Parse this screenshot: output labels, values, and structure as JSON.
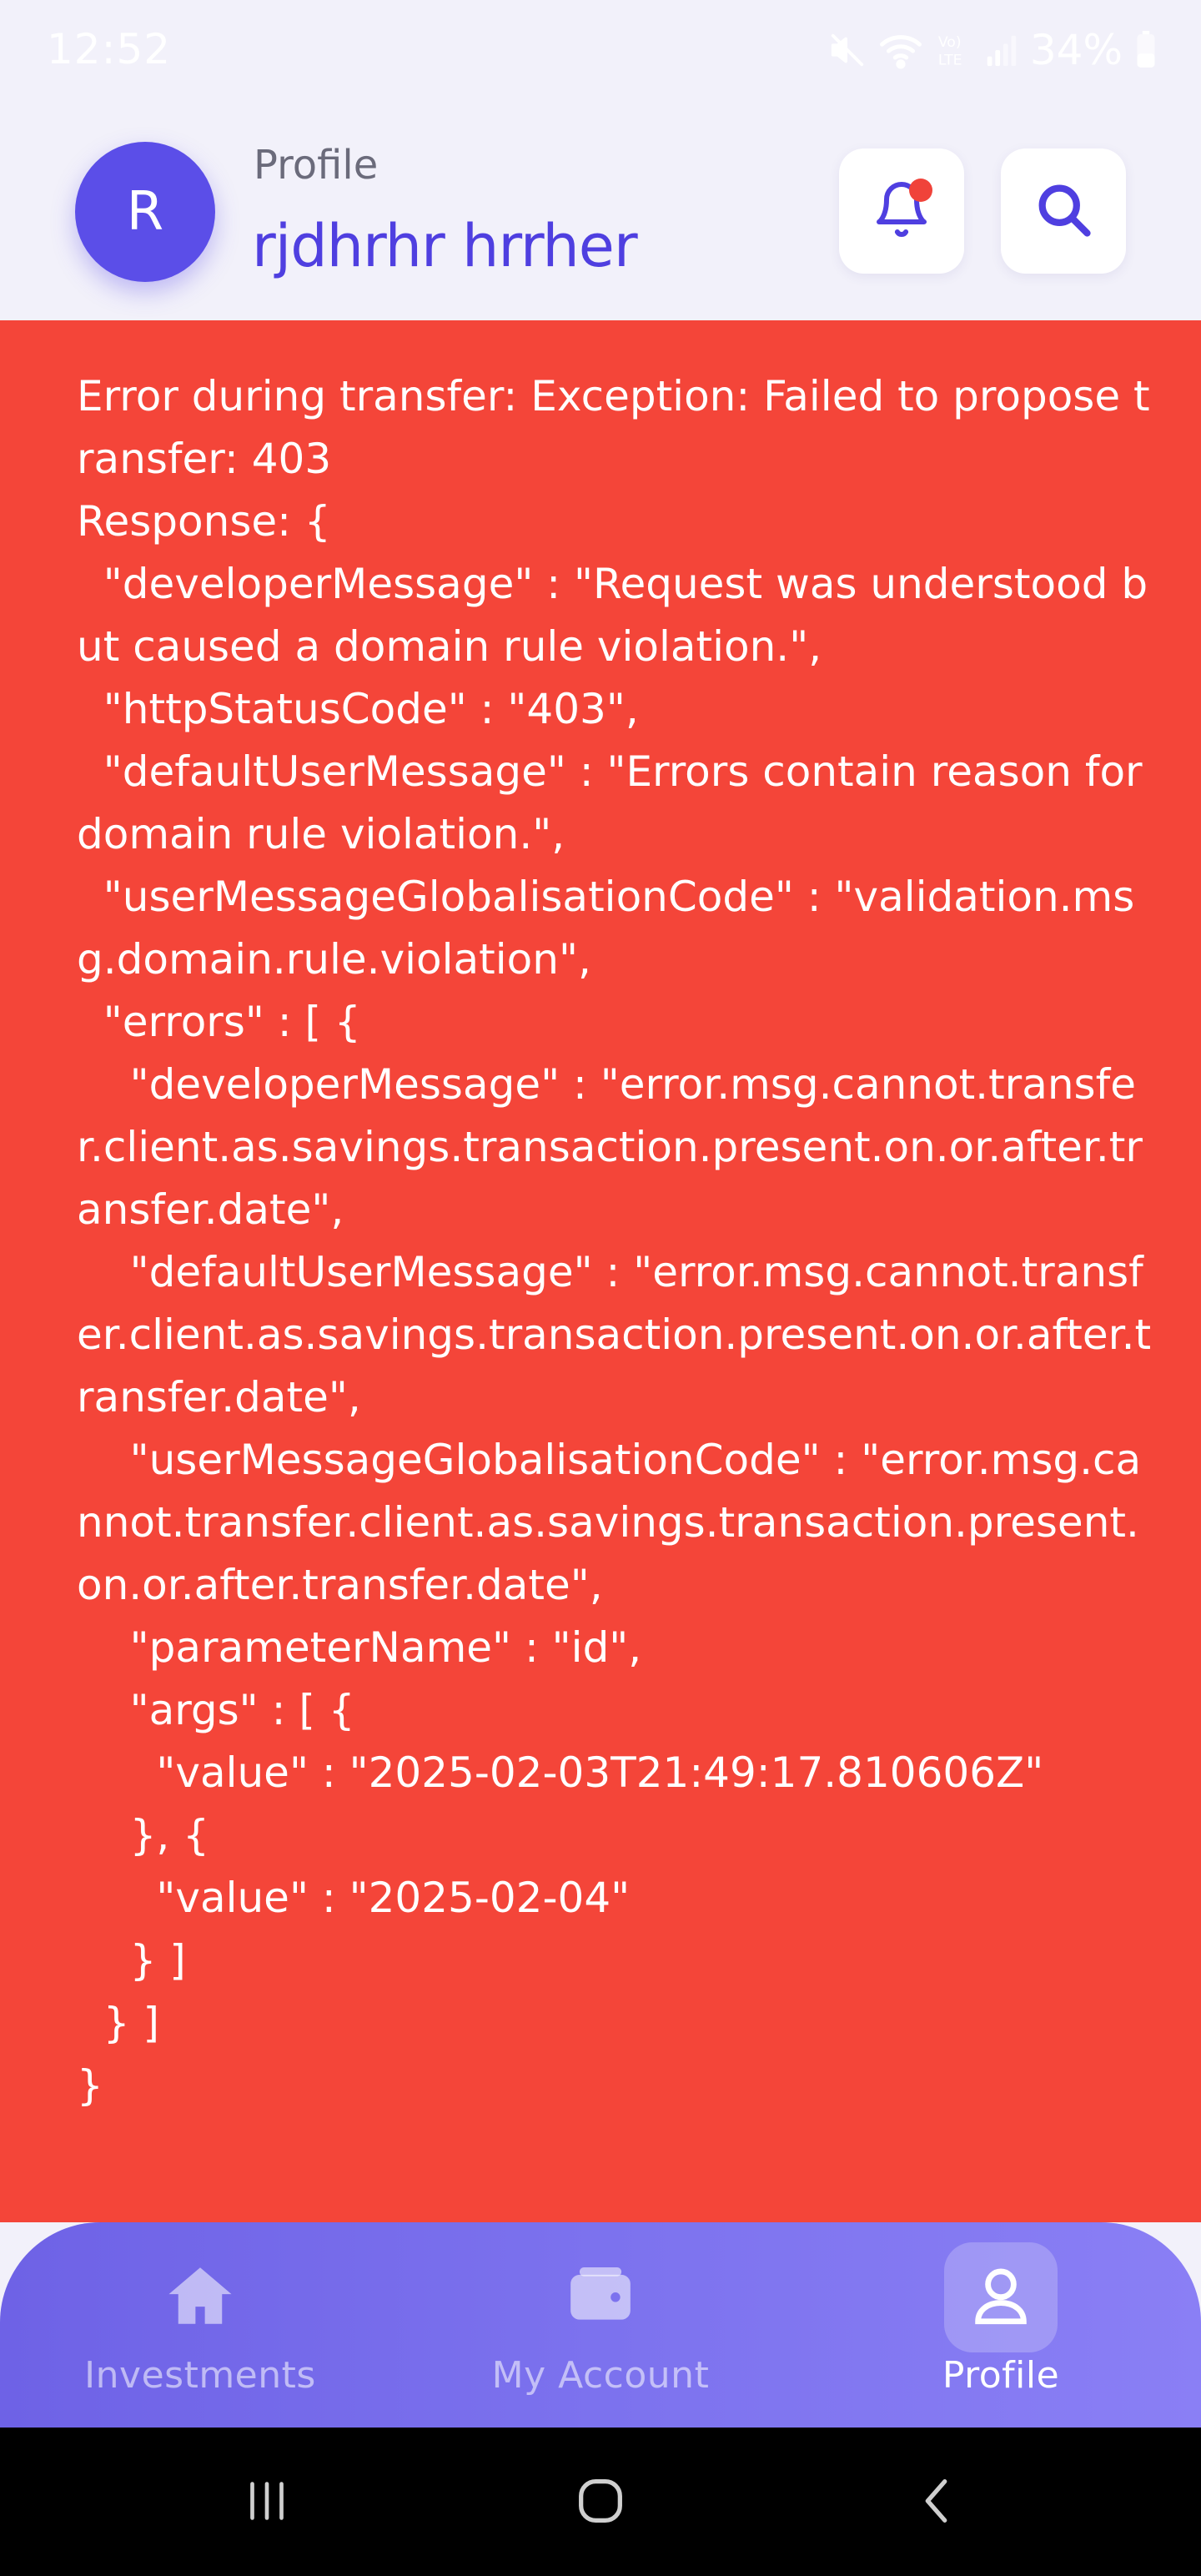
{
  "status_bar": {
    "time": "12:52",
    "battery_percent": "34%"
  },
  "header": {
    "avatar_initial": "R",
    "subtitle": "Profile",
    "user_name": "rjdhrhr hrrher",
    "notification_icon": "bell-icon",
    "search_icon": "search-icon"
  },
  "error": {
    "message": "Error during transfer: Exception: Failed to propose transfer: 403\nResponse: {\n  \"developerMessage\" : \"Request was understood but caused a domain rule violation.\",\n  \"httpStatusCode\" : \"403\",\n  \"defaultUserMessage\" : \"Errors contain reason for domain rule violation.\",\n  \"userMessageGlobalisationCode\" : \"validation.msg.domain.rule.violation\",\n  \"errors\" : [ {\n    \"developerMessage\" : \"error.msg.cannot.transfer.client.as.savings.transaction.present.on.or.after.transfer.date\",\n    \"defaultUserMessage\" : \"error.msg.cannot.transfer.client.as.savings.transaction.present.on.or.after.transfer.date\",\n    \"userMessageGlobalisationCode\" : \"error.msg.cannot.transfer.client.as.savings.transaction.present.on.or.after.transfer.date\",\n    \"parameterName\" : \"id\",\n    \"args\" : [ {\n      \"value\" : \"2025-02-03T21:49:17.810606Z\"\n    }, {\n      \"value\" : \"2025-02-04\"\n    } ]\n  } ]\n}",
    "background_color": "#F44539"
  },
  "bottom_nav": {
    "items": [
      {
        "label": "Investments",
        "icon": "home-icon",
        "active": false
      },
      {
        "label": "My Account",
        "icon": "wallet-icon",
        "active": false
      },
      {
        "label": "Profile",
        "icon": "user-icon",
        "active": true
      }
    ]
  },
  "colors": {
    "primary": "#4F3FE0",
    "avatar": "#5B4EE8",
    "notification_dot": "#F0433A",
    "page_background": "#F2F1FA"
  }
}
